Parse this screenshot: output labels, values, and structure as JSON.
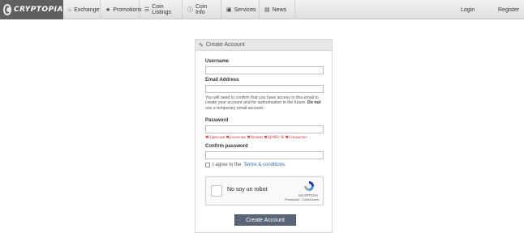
{
  "brand": {
    "logo_text": "CRYPTOPIA"
  },
  "nav": {
    "items": [
      {
        "label": "Exchange",
        "icon": "home-icon"
      },
      {
        "label": "Promotions",
        "icon": "star-icon"
      },
      {
        "label": "Coin Listings",
        "icon": "database-icon"
      },
      {
        "label": "Coin Info",
        "icon": "info-icon"
      },
      {
        "label": "Services",
        "icon": "briefcase-icon"
      },
      {
        "label": "News",
        "icon": "newspaper-icon"
      }
    ],
    "login": "Login",
    "register": "Register"
  },
  "form": {
    "heading": "Create Account",
    "username_label": "Username",
    "username_value": "",
    "email_label": "Email Address",
    "email_value": "",
    "email_help_1": "You will need to confirm that you have access to this email to create your account and for authorisation in the future. ",
    "email_help_bold": "Do not",
    "email_help_2": " use a temporary email account.",
    "password_label": "Password",
    "password_value": "",
    "password_requirements": "✖Uppercase ✖Lowercase ✖Number ✖!@#$%^& ✖8 characters",
    "confirm_label": "Confirm password",
    "confirm_value": "",
    "agree_prefix": "I agree to the",
    "agree_link": "Terms & conditions",
    "agree_suffix": ".",
    "captcha_label": "No soy un robot",
    "captcha_brand": "reCAPTCHA",
    "captcha_links": "Privacidad - Condiciones",
    "submit": "Create Account"
  },
  "colors": {
    "accent": "#5a6677",
    "link": "#2a6fb0",
    "error": "#c9302c",
    "logo_bg": "#5f5f5f"
  }
}
